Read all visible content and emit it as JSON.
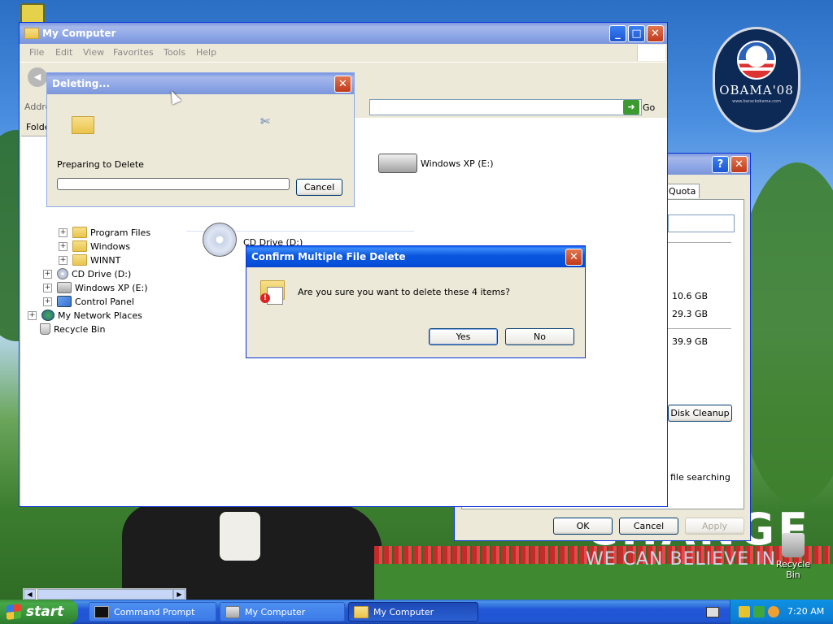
{
  "desktop": {
    "badge_text": "OBAMA'08",
    "badge_sub": "www.barackobama.com",
    "slogan": "WE CAN BELIEVE IN",
    "slogan_big": "CHANGE",
    "recycle_label": "Recycle Bin"
  },
  "mycomputer": {
    "title": "My Computer",
    "menu": [
      "File",
      "Edit",
      "View",
      "Favorites",
      "Tools",
      "Help"
    ],
    "address_label": "Address",
    "go_label": "Go",
    "folders_label": "Folders",
    "tree": [
      {
        "label": "Program Files",
        "icon": "folder-icon"
      },
      {
        "label": "Windows",
        "icon": "folder-icon"
      },
      {
        "label": "WINNT",
        "icon": "folder-icon"
      },
      {
        "label": "CD Drive (D:)",
        "icon": "cd-drive-icon"
      },
      {
        "label": "Windows XP (E:)",
        "icon": "drive-icon"
      },
      {
        "label": "Control Panel",
        "icon": "control-panel-icon"
      },
      {
        "label": "My Network Places",
        "icon": "network-icon"
      },
      {
        "label": "Recycle Bin",
        "icon": "recycle-bin-icon"
      }
    ],
    "content": {
      "drive_e": "Windows XP (E:)",
      "cd_drive": "CD Drive (D:)"
    }
  },
  "properties": {
    "tab_quota": "Quota",
    "used": "10.6 GB",
    "free": "29.3 GB",
    "capacity": "39.9 GB",
    "disk_cleanup": "Disk Cleanup",
    "indexing_text": "file searching",
    "ok": "OK",
    "cancel": "Cancel",
    "apply": "Apply"
  },
  "deleting": {
    "title": "Deleting...",
    "status": "Preparing to Delete",
    "progress": 0,
    "cancel": "Cancel"
  },
  "confirm": {
    "title": "Confirm Multiple File Delete",
    "message": "Are you sure you want to delete these 4 items?",
    "yes": "Yes",
    "no": "No"
  },
  "taskbar": {
    "start": "start",
    "tasks": [
      {
        "label": "Command Prompt",
        "active": false
      },
      {
        "label": "My Computer",
        "active": false
      },
      {
        "label": "My Computer",
        "active": true
      }
    ],
    "clock": "7:20 AM"
  }
}
